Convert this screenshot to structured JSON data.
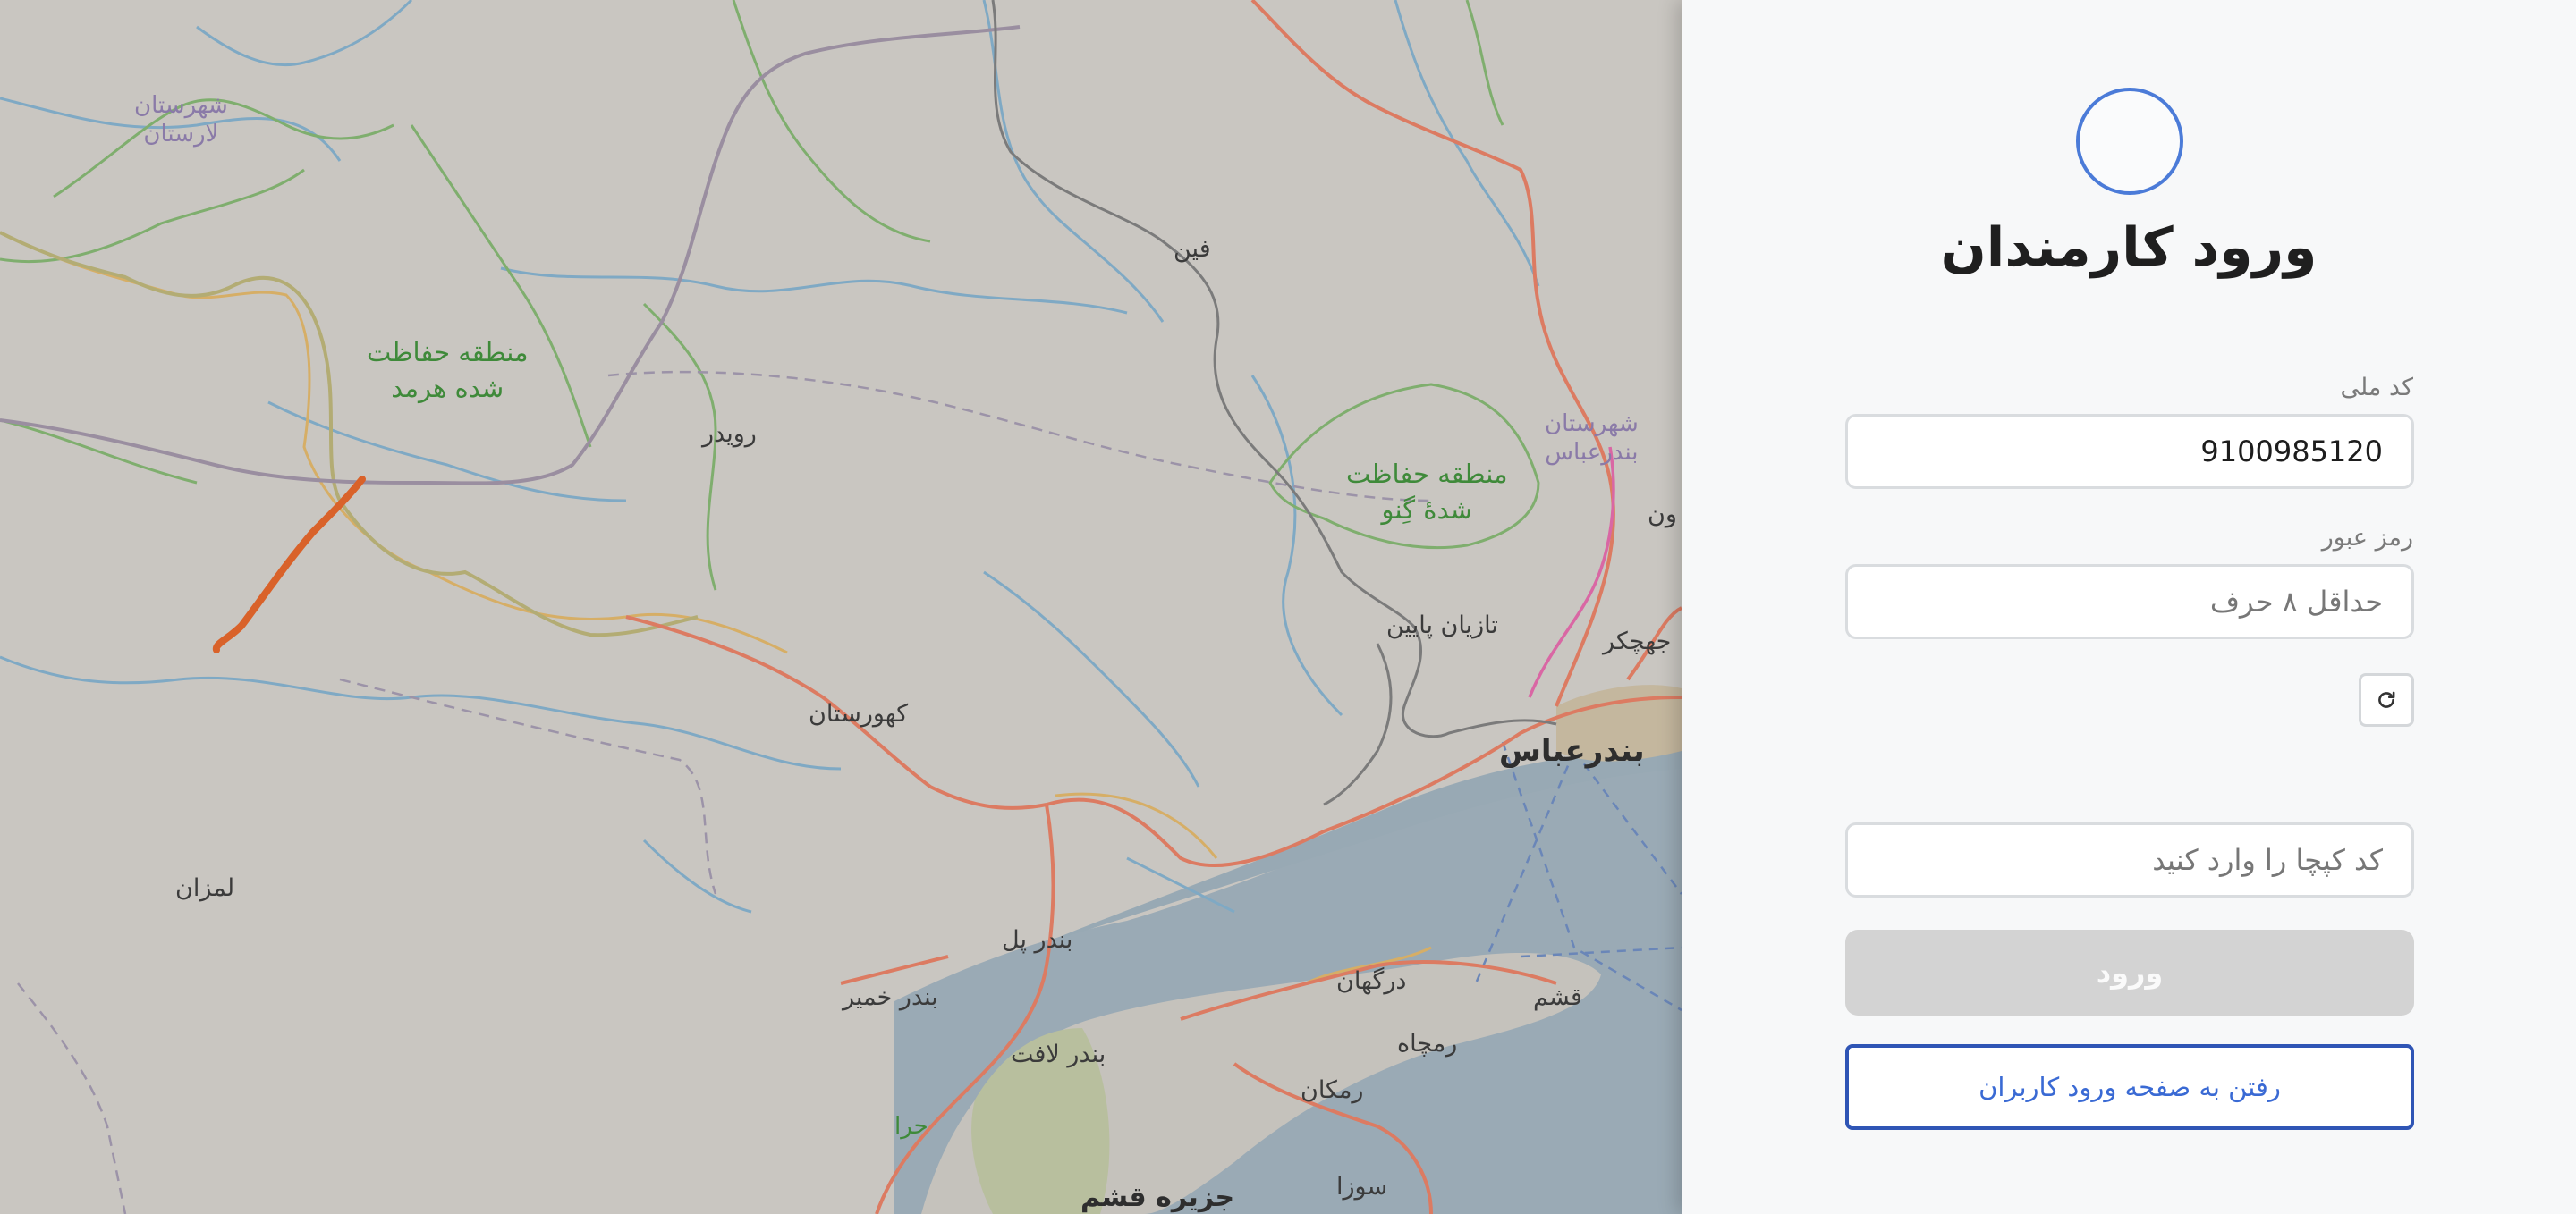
{
  "map": {
    "labels": {
      "shahrestan_larestan": "شهرستان\nلارستان",
      "hormod": "منطقه حفاظت\nشده هرمد",
      "ruydar": "رویدر",
      "fin": "فین",
      "geno": "منطقه حفاظت\nشدهٔ گِنو",
      "shahrestan_bandarabbas": "شهرستان\nبندرعباس",
      "tazian_payin": "تازیان پایین",
      "jahchekar": "جهچکر",
      "bandarabbas": "بندرعباس",
      "kahurestan": "کهورستان",
      "lemzan": "لمزان",
      "bandar_pol": "بندر پل",
      "bandar_khamir": "بندر خمیر",
      "dargahan": "درگهان",
      "qeshm": "قشم",
      "bandar_laft": "بندر لافت",
      "ramcheh": "رمچاه",
      "ramkan": "رمکان",
      "hara": "حرا",
      "suza": "سوزا",
      "jazireh_qeshm": "جزیره قشم",
      "partial_un": "ون"
    }
  },
  "login": {
    "title": "ورود کارمندان",
    "national_code_label": "کد ملی",
    "national_code_value": "9100985120",
    "password_label": "رمز عبور",
    "password_placeholder": "حداقل ۸ حرف",
    "refresh_icon": "refresh-icon",
    "captcha_placeholder": "کد کپچا را وارد کنید",
    "submit_label": "ورود",
    "goto_users_label": "رفتن به صفحه ورود کاربران"
  },
  "colors": {
    "accent_blue": "#2f55b5",
    "link_blue": "#3a6ad4",
    "logo_ring": "#4b7bd8",
    "disabled_button": "#d3d3d3",
    "route_orange": "#d9622a"
  }
}
